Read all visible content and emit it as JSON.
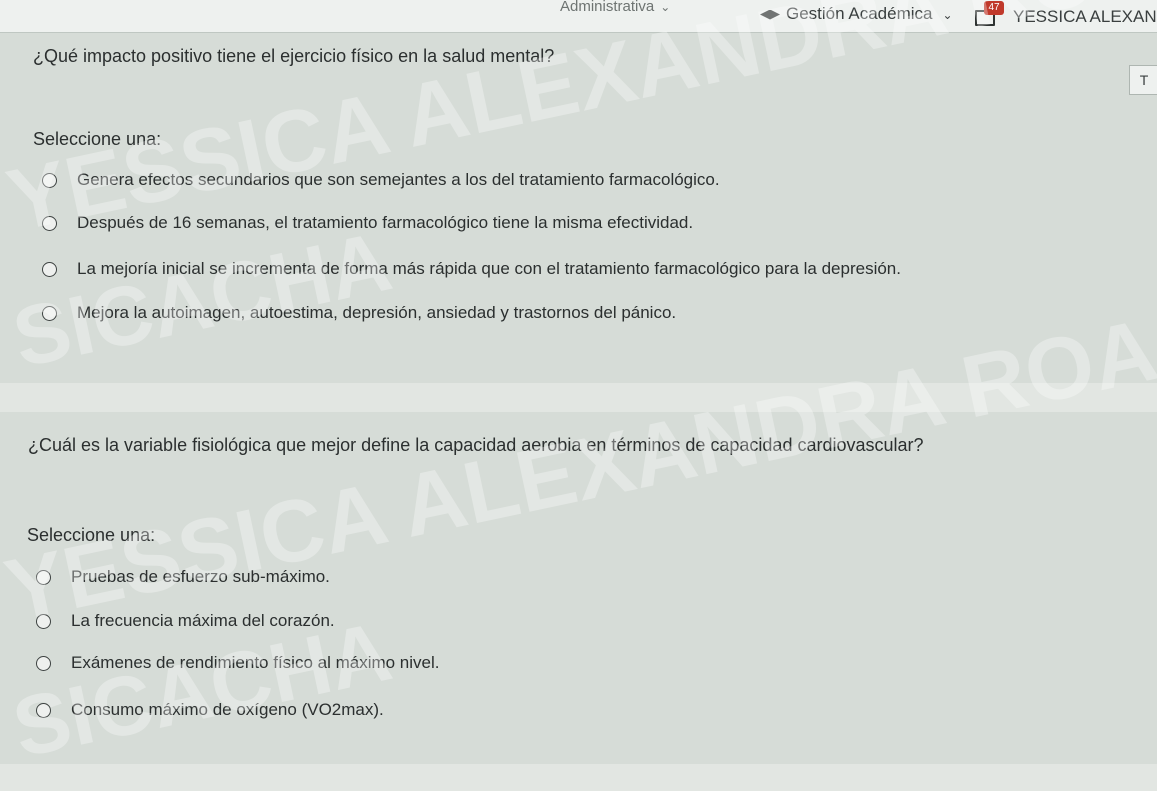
{
  "topbar": {
    "admin_label": "Administrativa",
    "gestion_label": "Gestión Académica",
    "message_badge": "47",
    "user_name": "YESSICA ALEXAND"
  },
  "flag_label": "T",
  "questions": [
    {
      "text": "¿Qué impacto positivo tiene el ejercicio físico en la salud mental?",
      "prompt": "Seleccione una:",
      "options": [
        "Genera efectos secundarios que son semejantes a los del tratamiento farmacológico.",
        "Después de 16 semanas, el tratamiento farmacológico tiene la misma efectividad.",
        "La mejoría inicial se incrementa de forma más rápida que con el tratamiento farmacológico para la depresión.",
        "Mejora la autoimagen, autoestima, depresión, ansiedad y trastornos del pánico."
      ]
    },
    {
      "text": "¿Cuál es la variable fisiológica que mejor define la capacidad aerobia en términos de capacidad cardiovascular?",
      "prompt": "Seleccione una:",
      "options": [
        "Pruebas de esfuerzo sub-máximo.",
        "La frecuencia máxima del corazón.",
        "Exámenes de rendimiento físico al máximo nivel.",
        "Consumo máximo de oxígeno (VO2max)."
      ]
    }
  ],
  "watermark": {
    "line1": "YESSICA ALEXANDRA ROA",
    "line2": "SICACHA"
  }
}
